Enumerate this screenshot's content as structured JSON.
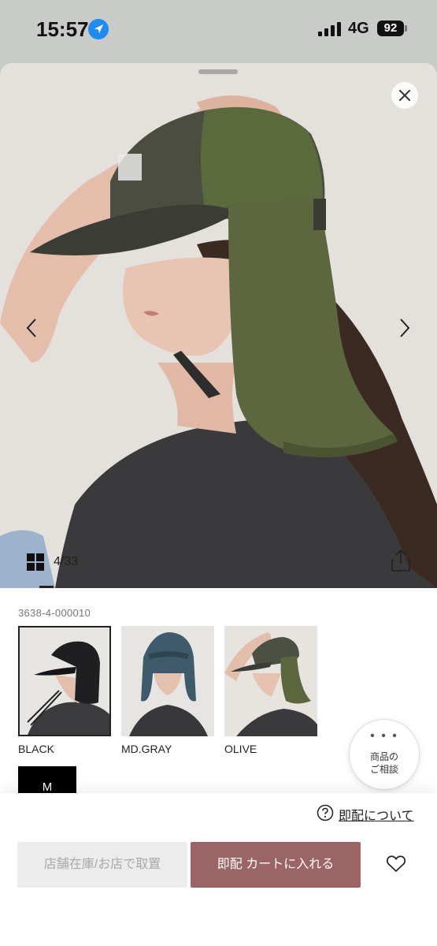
{
  "status_bar": {
    "time": "15:57",
    "network": "4G",
    "battery": "92"
  },
  "gallery": {
    "counter": "4/33"
  },
  "product": {
    "code": "3638-4-000010",
    "colors": [
      {
        "label": "BLACK",
        "selected": true
      },
      {
        "label": "MD.GRAY",
        "selected": false
      },
      {
        "label": "OLIVE",
        "selected": false
      }
    ],
    "size": "M"
  },
  "consult": {
    "line1": "商品の",
    "line2": "ご相談"
  },
  "footer": {
    "delivery_link": "即配について",
    "store_button": "店舗在庫/お店で取置",
    "cart_button": "即配 カートに入れる"
  },
  "icons": {
    "location": "location-arrow-icon",
    "close": "close-icon",
    "grid": "grid-icon",
    "share": "share-icon",
    "help": "question-circle-icon",
    "favorite": "heart-icon"
  },
  "colors": {
    "accent": "#9b6565",
    "location_blue": "#1e8cf0",
    "disabled_bg": "#ececec"
  }
}
